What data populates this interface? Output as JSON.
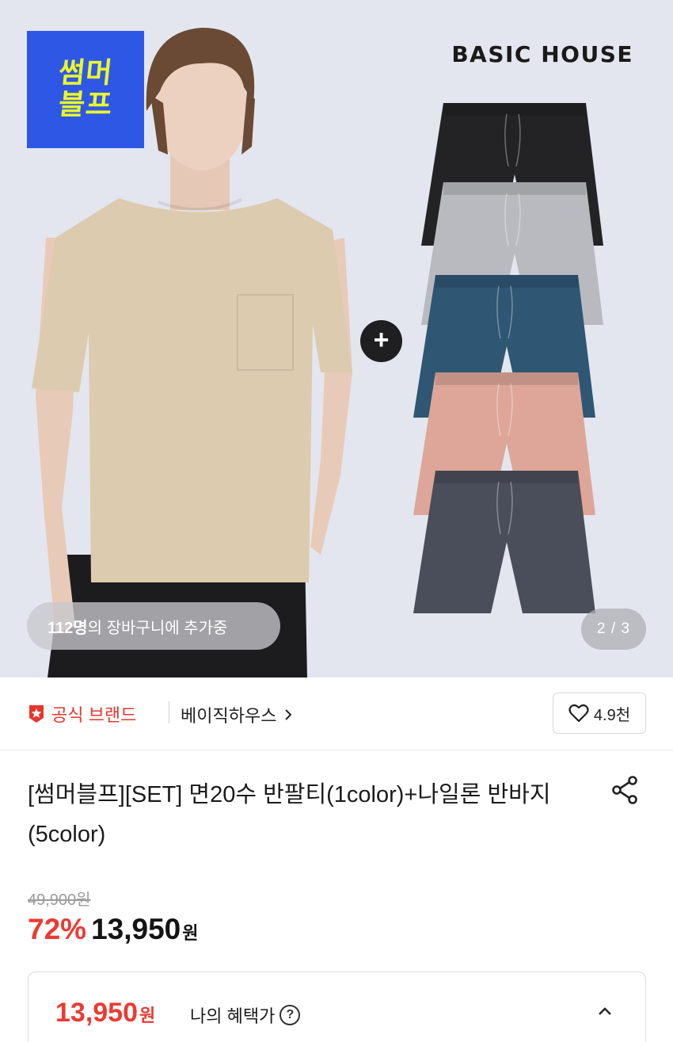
{
  "hero": {
    "promo_badge_line1": "썸머",
    "promo_badge_line2": "블프",
    "brand_logo": "BASIC HOUSE",
    "plus_symbol": "+",
    "cart_count": "112명",
    "cart_text": "의 장바구니에 추가중",
    "page_indicator": "2 / 3",
    "shorts_colors": [
      "#232325",
      "#b9babf",
      "#2f5673",
      "#dda698",
      "#4a4e5b"
    ],
    "tee_color": "#dccbae"
  },
  "brand_row": {
    "official_label": "공식 브랜드",
    "brand_name": "베이직하우스",
    "like_count": "4.9천",
    "official_icon": "star-shield-icon",
    "like_icon": "heart-icon"
  },
  "product": {
    "title": "[썸머블프][SET] 면20수 반팔티(1color)+나일론 반바지(5color)",
    "share_icon": "share-icon"
  },
  "price": {
    "original": "49,900원",
    "discount": "72%",
    "sale": "13,950",
    "currency": "원"
  },
  "benefit": {
    "price": "13,950",
    "currency": "원",
    "label": "나의 혜택가",
    "help_symbol": "?"
  },
  "colors": {
    "accent_red": "#ea3b34",
    "promo_blue": "#2f57e6",
    "promo_yellow": "#e9f82a"
  }
}
